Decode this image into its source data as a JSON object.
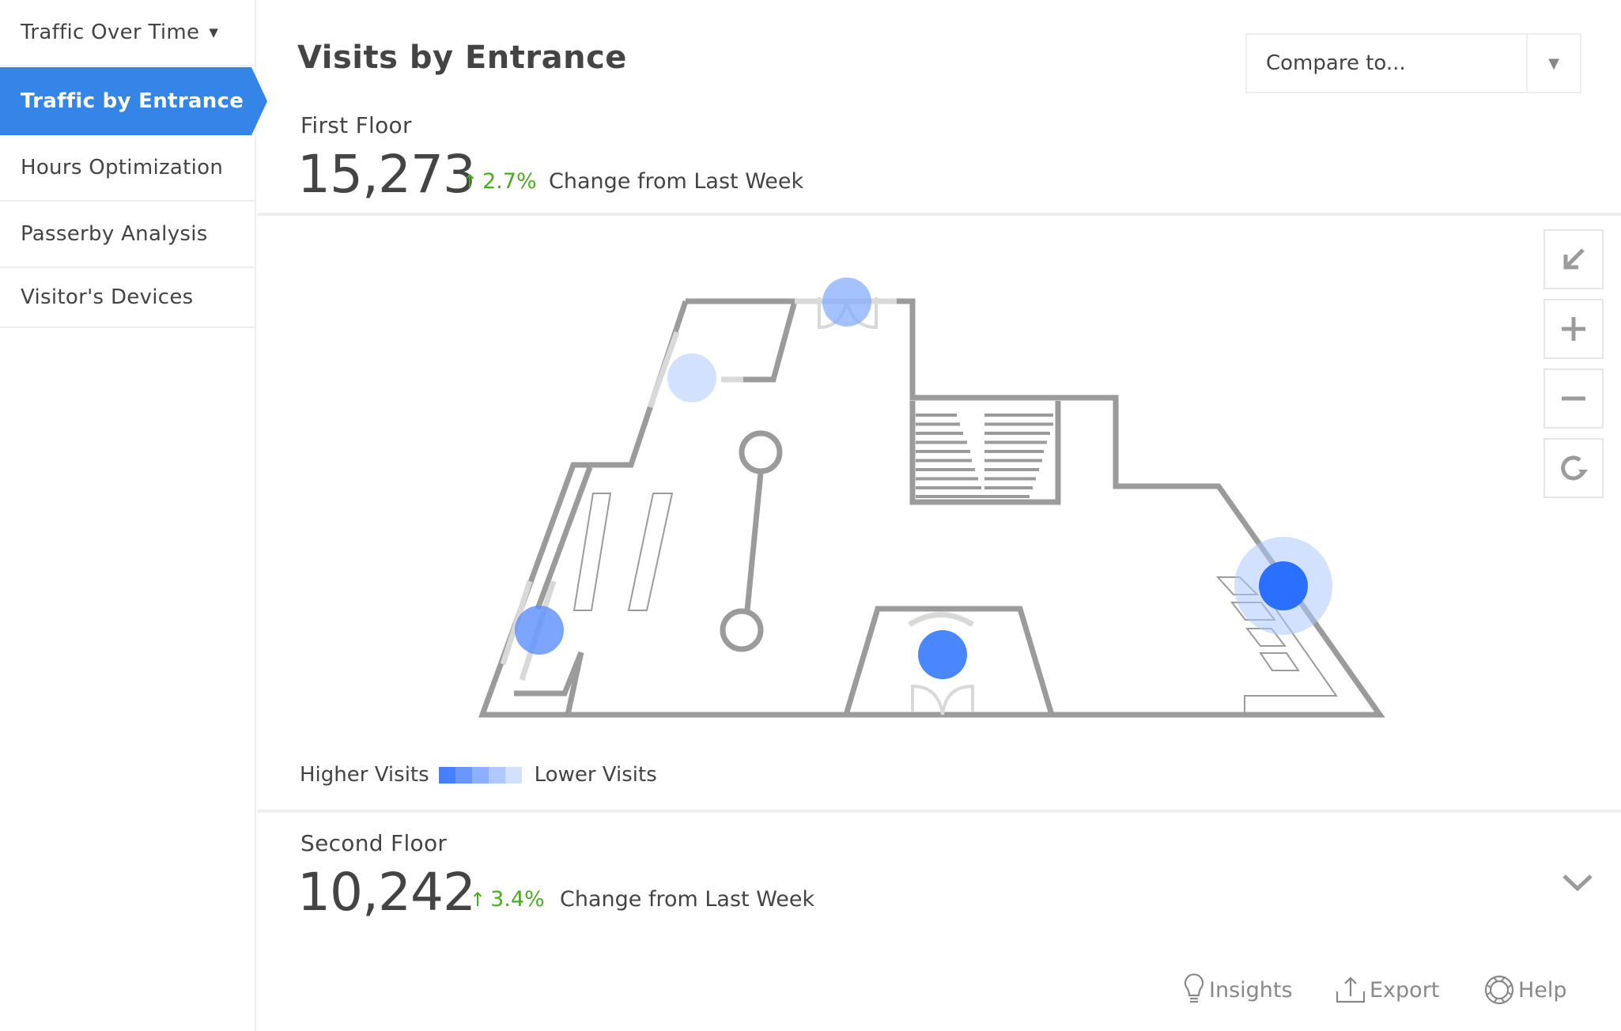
{
  "sidebar": {
    "items": [
      {
        "label": "Traffic Over Time",
        "has_dropdown": true,
        "active": false
      },
      {
        "label": "Traffic by Entrance",
        "active": true
      },
      {
        "label": "Hours Optimization",
        "active": false
      },
      {
        "label": "Passerby Analysis",
        "active": false
      },
      {
        "label": "Visitor's Devices",
        "active": false
      }
    ],
    "dropdown_caret": "▼"
  },
  "header": {
    "title": "Visits by Entrance",
    "compare": {
      "label": "Compare to...",
      "arrow": "▼"
    }
  },
  "floors": [
    {
      "name": "First Floor",
      "count": "15,273",
      "change": "2.7%",
      "change_direction": "up",
      "change_label": "Change from Last Week",
      "expanded": true
    },
    {
      "name": "Second Floor",
      "count": "10,242",
      "change": "3.4%",
      "change_direction": "up",
      "change_label": "Change from Last Week",
      "expanded": false
    }
  ],
  "arrow_up": "↑",
  "map": {
    "controls": [
      {
        "name": "reset-view",
        "icon": "arrow-down-left-icon"
      },
      {
        "name": "zoom-in",
        "icon": "plus-icon"
      },
      {
        "name": "zoom-out",
        "icon": "minus-icon"
      },
      {
        "name": "refresh",
        "icon": "refresh-icon"
      }
    ],
    "entrances": [
      {
        "name": "north-entrance",
        "level": 3
      },
      {
        "name": "northwest-entrance",
        "level": 1
      },
      {
        "name": "west-entrance",
        "level": 4
      },
      {
        "name": "south-entrance",
        "level": 5
      },
      {
        "name": "east-entrance",
        "level": 6
      }
    ]
  },
  "legend": {
    "high_label": "Higher Visits",
    "low_label": "Lower Visits",
    "colors": [
      "#4680fe",
      "#6b97fd",
      "#8cb0fd",
      "#afc8fd",
      "#d2e1fe"
    ]
  },
  "colors": {
    "accent": "#3584e8",
    "positive": "#4aad1f",
    "wall": "#9b9b9b",
    "wall_light": "#d9d9d9"
  },
  "footer": {
    "insights": "Insights",
    "export": "Export",
    "help": "Help"
  }
}
